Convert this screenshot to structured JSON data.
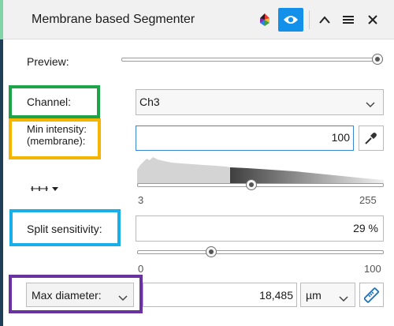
{
  "header": {
    "title": "Membrane based Segmenter",
    "color_icon": "color-wheel-icon",
    "eye_icon": "eye-icon",
    "collapse_icon": "chevron-up-icon",
    "menu_icon": "menu-icon",
    "close_icon": "close-icon",
    "accent": "#1391ea"
  },
  "preview": {
    "label": "Preview:",
    "level": 1.0
  },
  "channel": {
    "label": "Channel:",
    "value": "Ch3"
  },
  "min_intensity": {
    "label_line1": "Min intensity:",
    "label_line2": "(membrane):",
    "value": "100",
    "eyedropper_icon": "eyedropper-icon",
    "range_icon": "range-mode-icon",
    "histogram": {
      "min_label": "3",
      "max_label": "255",
      "slider_fraction": 0.46
    }
  },
  "split": {
    "label": "Split sensitivity:",
    "value": "29 %",
    "slider_fraction": 0.29,
    "min_label": "0",
    "max_label": "100"
  },
  "max_diameter": {
    "label": "Max diameter:",
    "value": "18,485",
    "unit": "µm",
    "ruler_icon": "measure-ruler-icon"
  },
  "frames": {
    "green": "#1fa348",
    "yellow": "#f4b400",
    "blue": "#18aee8",
    "purple": "#6a31a0"
  }
}
